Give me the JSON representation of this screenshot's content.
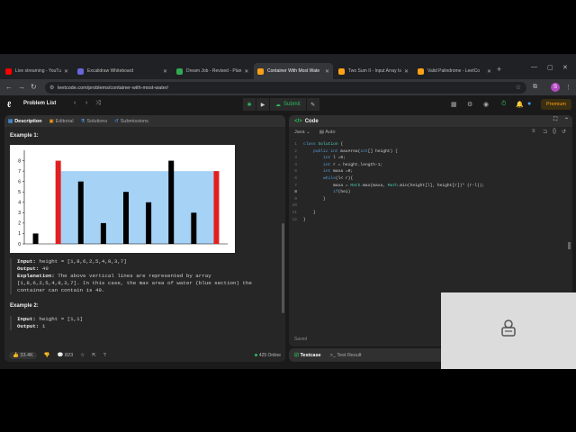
{
  "browser": {
    "tabs": [
      {
        "title": "Live streaming - YouTu",
        "favicon_color": "#ff0000",
        "icon": "youtube-icon",
        "active": false
      },
      {
        "title": "Excalidraw Whiteboard",
        "favicon_color": "#6965db",
        "icon": "excalidraw-icon",
        "active": false
      },
      {
        "title": "Dream Job - Revised - Plan",
        "favicon_color": "#34a853",
        "icon": "sheets-icon",
        "active": false
      },
      {
        "title": "Container With Most Wate",
        "favicon_color": "#ffa116",
        "icon": "leetcode-icon",
        "active": true
      },
      {
        "title": "Two Sum II - Input Array Is",
        "favicon_color": "#ffa116",
        "icon": "leetcode-icon",
        "active": false
      },
      {
        "title": "Valid Palindrome - LeetCo",
        "favicon_color": "#ffa116",
        "icon": "leetcode-icon",
        "active": false
      }
    ],
    "url": "leetcode.com/problems/container-with-most-water/",
    "profile_initial": "S"
  },
  "leetcode": {
    "problem_list": "Problem List",
    "submit": "Submit",
    "premium": "Premium"
  },
  "left": {
    "tabs": [
      "Description",
      "Editorial",
      "Solutions",
      "Submissions"
    ],
    "example1_title": "Example 1:",
    "example1_input_label": "Input:",
    "example1_input": " height = [1,8,6,2,5,4,8,3,7]",
    "example1_output_label": "Output:",
    "example1_output": " 49",
    "example1_expl_label": "Explanation:",
    "example1_expl": " The above vertical lines are represented by array [1,8,6,2,5,4,8,3,7]. In this case, the max area of water (blue section) the container can contain is 49.",
    "example2_title": "Example 2:",
    "example2_input_label": "Input:",
    "example2_input": " height = [1,1]",
    "example2_output_label": "Output:",
    "example2_output": " 1",
    "likes": "33.4K",
    "comments": "823",
    "online": "425 Online"
  },
  "chart_data": {
    "type": "bar",
    "categories": [
      "1",
      "2",
      "3",
      "4",
      "5",
      "6",
      "7",
      "8",
      "9"
    ],
    "values": [
      1,
      8,
      6,
      2,
      5,
      4,
      8,
      3,
      7
    ],
    "highlight_indices": [
      1,
      8
    ],
    "highlight_color": "#e02020",
    "bar_color": "#000000",
    "water_level": 7,
    "water_color": "#a6d2f6",
    "ylim": [
      0,
      9
    ],
    "yticks": [
      "0",
      "1",
      "2",
      "3",
      "4",
      "5",
      "6",
      "7",
      "8"
    ]
  },
  "right": {
    "title": "Code",
    "language": "Java",
    "mode": "Auto",
    "code_lines": [
      "class Solution {",
      "    public int maxArea(int[] height) {",
      "        int l =0;",
      "        int r = height.length-1;",
      "        int maxa =0;",
      "        while(l< r){",
      "            maxa = Math.max(maxa, Math.min(height[l], height[r])* (r-l));",
      "            if(hei)",
      "        }",
      "",
      "    }",
      "}"
    ],
    "current_line": 8,
    "saved": "Saved",
    "testcase_tab": "Testcase",
    "result_tab": "Test Result"
  }
}
